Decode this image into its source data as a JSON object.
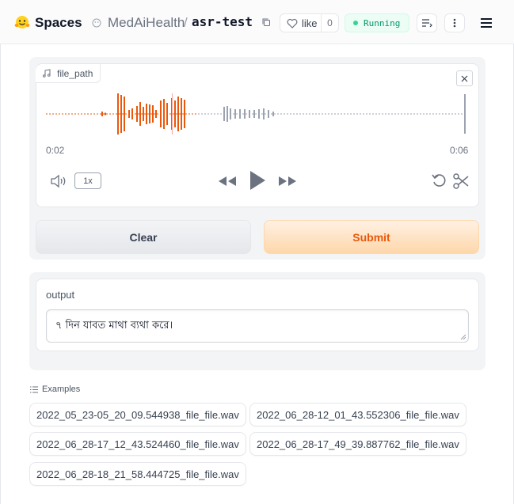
{
  "header": {
    "spaces_label": "Spaces",
    "owner": "MedAiHealth",
    "separator": "/",
    "repo": "asr-test",
    "like_label": "like",
    "like_count": "0",
    "status": "Running",
    "status_color": "#059669"
  },
  "input": {
    "label": "file_path",
    "current_time": "0:02",
    "duration": "0:06",
    "playback_progress": 0.36,
    "speed": "1x",
    "accent": "#ea580c"
  },
  "buttons": {
    "clear": "Clear",
    "submit": "Submit"
  },
  "output": {
    "label": "output",
    "value": "৭ দিন যাবত মাথা ব্যথা করে।"
  },
  "examples": {
    "label": "Examples",
    "items": [
      "2022_05_23-05_20_09.544938_file_file.wav",
      "2022_06_28-12_01_43.552306_file_file.wav",
      "2022_06_28-17_12_43.524460_file_file.wav",
      "2022_06_28-17_49_39.887762_file_file.wav",
      "2022_06_28-18_21_58.444725_file_file.wav"
    ]
  }
}
